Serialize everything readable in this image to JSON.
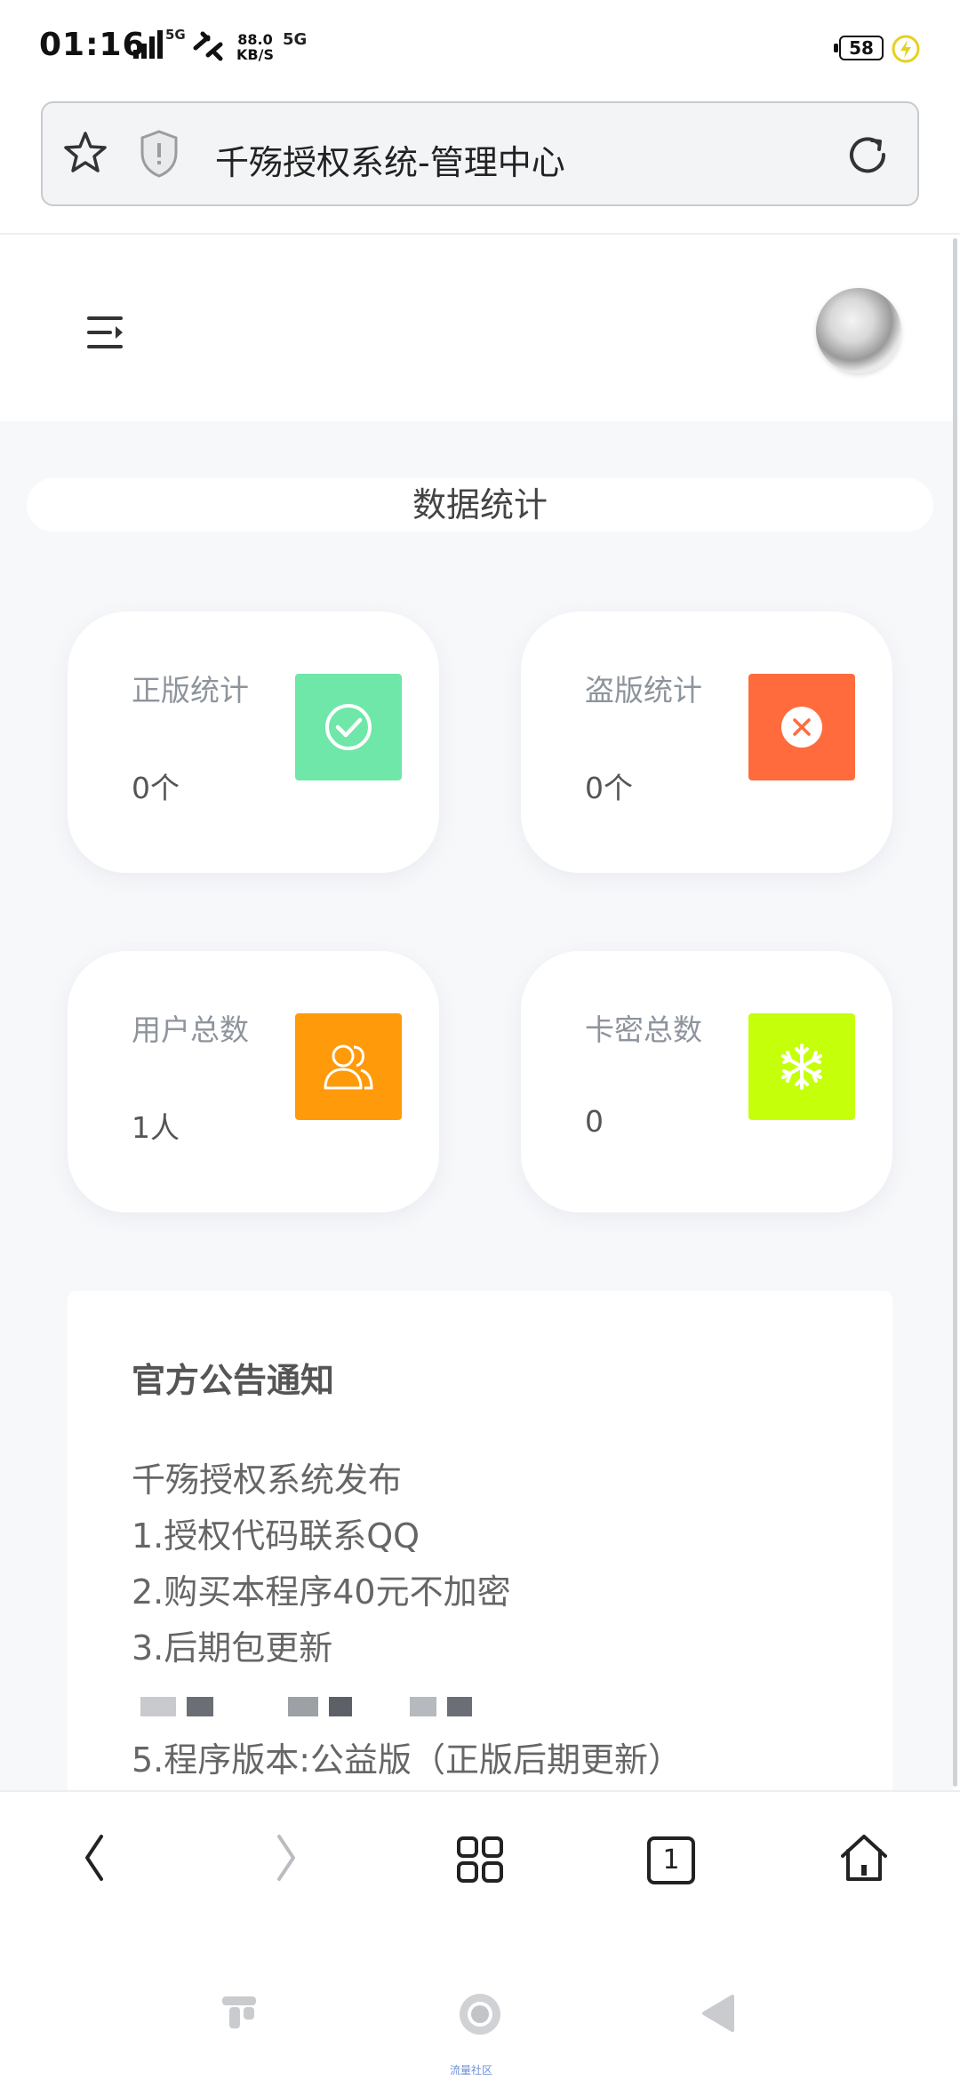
{
  "status_bar": {
    "time": "01:16",
    "signal_label": "5G",
    "net_speed_value": "88.0",
    "net_speed_unit": "KB/S",
    "network_badge": "5G",
    "battery_level": "58"
  },
  "browser": {
    "page_title": "千殇授权系统-管理中心"
  },
  "dashboard": {
    "section_title": "数据统计",
    "cards": [
      {
        "label": "正版统计",
        "value": "0个",
        "icon": "check-circle-icon",
        "color": "#6ee7a8"
      },
      {
        "label": "盗版统计",
        "value": "0个",
        "icon": "close-circle-icon",
        "color": "#ff6b3d"
      },
      {
        "label": "用户总数",
        "value": "1人",
        "icon": "users-icon",
        "color": "#ff9a0a"
      },
      {
        "label": "卡密总数",
        "value": "0",
        "icon": "snowflake-icon",
        "color": "#c6ff0a"
      }
    ]
  },
  "notice": {
    "title": "官方公告通知",
    "lines": [
      "千殇授权系统发布",
      "1.授权代码联系QQ",
      "2.购买本程序40元不加密",
      "3.后期包更新",
      "",
      "5.程序版本:公益版（正版后期更新）"
    ]
  },
  "bottom_nav": {
    "tab_count": "1"
  },
  "system_nav": {
    "caption": "流量社区"
  }
}
